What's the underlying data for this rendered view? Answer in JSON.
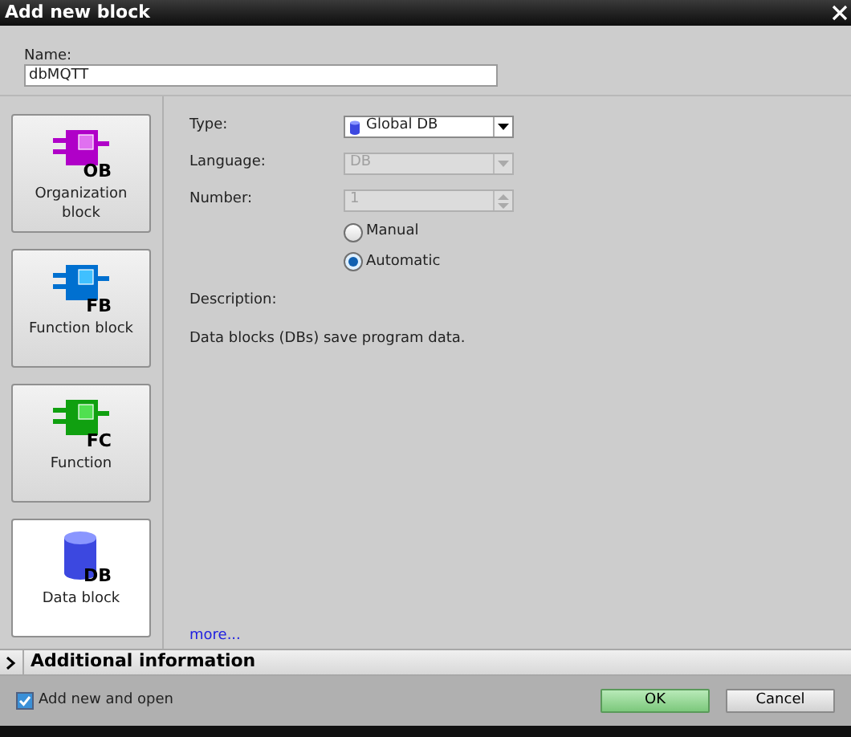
{
  "window": {
    "title": "Add new block"
  },
  "name": {
    "label": "Name:",
    "value": "dbMQTT"
  },
  "blocks": [
    {
      "kind": "ob",
      "badge": "OB",
      "label": "Organization block",
      "selected": false
    },
    {
      "kind": "fb",
      "badge": "FB",
      "label": "Function block",
      "selected": false
    },
    {
      "kind": "fc",
      "badge": "FC",
      "label": "Function",
      "selected": false
    },
    {
      "kind": "db",
      "badge": "DB",
      "label": "Data block",
      "selected": true
    }
  ],
  "type": {
    "label": "Type:",
    "value": "Global DB"
  },
  "language": {
    "label": "Language:",
    "value": "DB",
    "disabled": true
  },
  "number": {
    "label": "Number:",
    "value": "1",
    "disabled": true
  },
  "numbering": [
    {
      "label": "Manual",
      "selected": false
    },
    {
      "label": "Automatic",
      "selected": true
    }
  ],
  "description": {
    "label": "Description:",
    "text": "Data blocks (DBs) save program data."
  },
  "more_link": "more...",
  "additional_information": {
    "label": "Additional information",
    "expanded": false
  },
  "add_new_and_open": {
    "label": "Add new and open",
    "checked": true
  },
  "buttons": [
    {
      "label": "OK",
      "kind": "primary"
    },
    {
      "label": "Cancel",
      "kind": "secondary"
    }
  ]
}
